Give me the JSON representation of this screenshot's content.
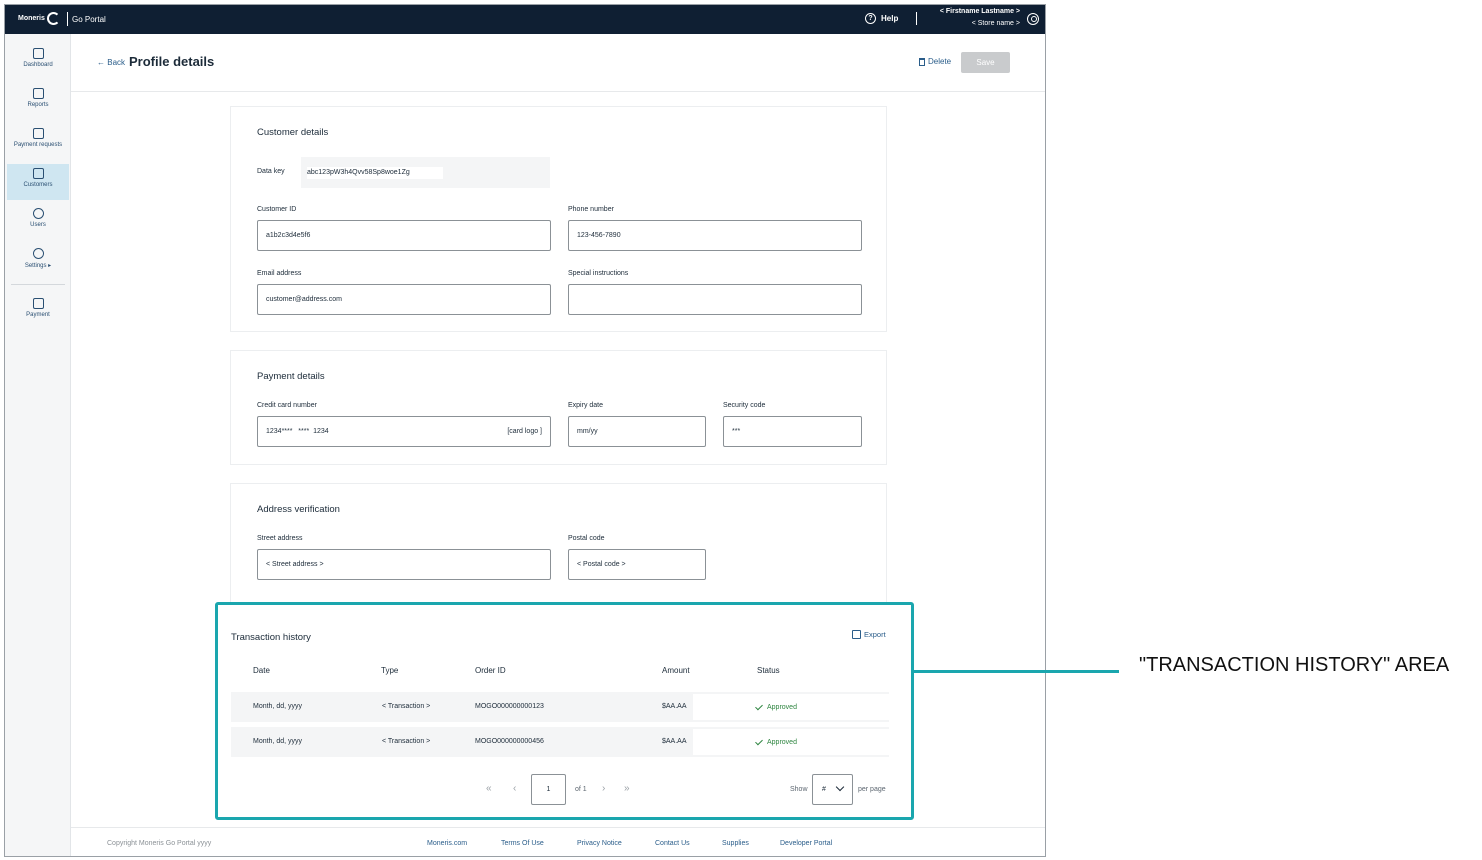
{
  "topbar": {
    "brand": "Moneris",
    "product": "Go Portal",
    "help": "Help",
    "user_name": "< Firstname Lastname >",
    "store_name": "< Store name >"
  },
  "sidebar": {
    "items": [
      {
        "label": "Dashboard"
      },
      {
        "label": "Reports"
      },
      {
        "label": "Payment requests"
      },
      {
        "label": "Customers"
      },
      {
        "label": "Users"
      },
      {
        "label": "Settings"
      },
      {
        "label": "Payment"
      }
    ]
  },
  "header": {
    "back": "Back",
    "title": "Profile details",
    "delete": "Delete",
    "save": "Save"
  },
  "customer": {
    "title": "Customer details",
    "data_key_label": "Data key",
    "data_key_value": "abc123pW3h4Qvv58Sp8woe1Zg",
    "customer_id_label": "Customer ID",
    "customer_id_value": "a1b2c3d4e5f6",
    "phone_label": "Phone number",
    "phone_value": "123-456-7890",
    "email_label": "Email address",
    "email_value": "customer@address.com",
    "instructions_label": "Special instructions",
    "instructions_value": ""
  },
  "payment": {
    "title": "Payment details",
    "card_label": "Credit card number",
    "card_value": "1234****   ****  1234",
    "card_logo": "[card logo ]",
    "expiry_label": "Expiry date",
    "expiry_value": "mm/yy",
    "cvv_label": "Security code",
    "cvv_value": "***"
  },
  "address": {
    "title": "Address verification",
    "street_label": "Street address",
    "street_value": "< Street address >",
    "postal_label": "Postal code",
    "postal_value": "< Postal code >"
  },
  "transactions": {
    "title": "Transaction history",
    "export": "Export",
    "columns": [
      "Date",
      "Type",
      "Order ID",
      "Amount",
      "Status"
    ],
    "rows": [
      {
        "date": "Month, dd, yyyy",
        "type": "< Transaction >",
        "order_id": "MOGO000000000123",
        "amount": "$AA.AA",
        "status": "Approved"
      },
      {
        "date": "Month, dd, yyyy",
        "type": "< Transaction >",
        "order_id": "MOGO000000000456",
        "amount": "$AA.AA",
        "status": "Approved"
      }
    ],
    "page": "1",
    "of": "of 1",
    "show": "Show",
    "per_page_value": "#",
    "per_page": "per page"
  },
  "footer": {
    "copyright": "Copyright Moneris Go Portal  yyyy",
    "links": [
      "Moneris.com",
      "Terms Of Use",
      "Privacy Notice",
      "Contact Us",
      "Supplies",
      "Developer Portal"
    ]
  },
  "annotation": {
    "label": "\"TRANSACTION HISTORY\" AREA"
  },
  "colors": {
    "topbar": "#0f1f33",
    "highlight": "#1aa6ae",
    "approved": "#2e8540",
    "active_nav": "#cfe6f1"
  }
}
